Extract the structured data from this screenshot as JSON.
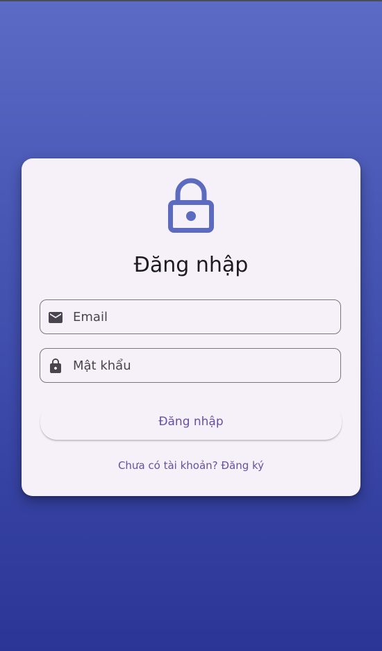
{
  "login": {
    "title": "Đăng nhập",
    "email_placeholder": "Email",
    "password_placeholder": "Mật khẩu",
    "submit_label": "Đăng nhập",
    "register_link": "Chưa có tài khoản? Đăng ký"
  },
  "icons": {
    "logo": "lock-icon",
    "email": "mail-icon",
    "password": "lock-icon"
  },
  "colors": {
    "primary": "#5c6bc0",
    "accent_text": "#6750a4",
    "card_background": "#f6f1f9",
    "gradient_top": "#5c6bc5",
    "gradient_bottom": "#2b3596"
  }
}
